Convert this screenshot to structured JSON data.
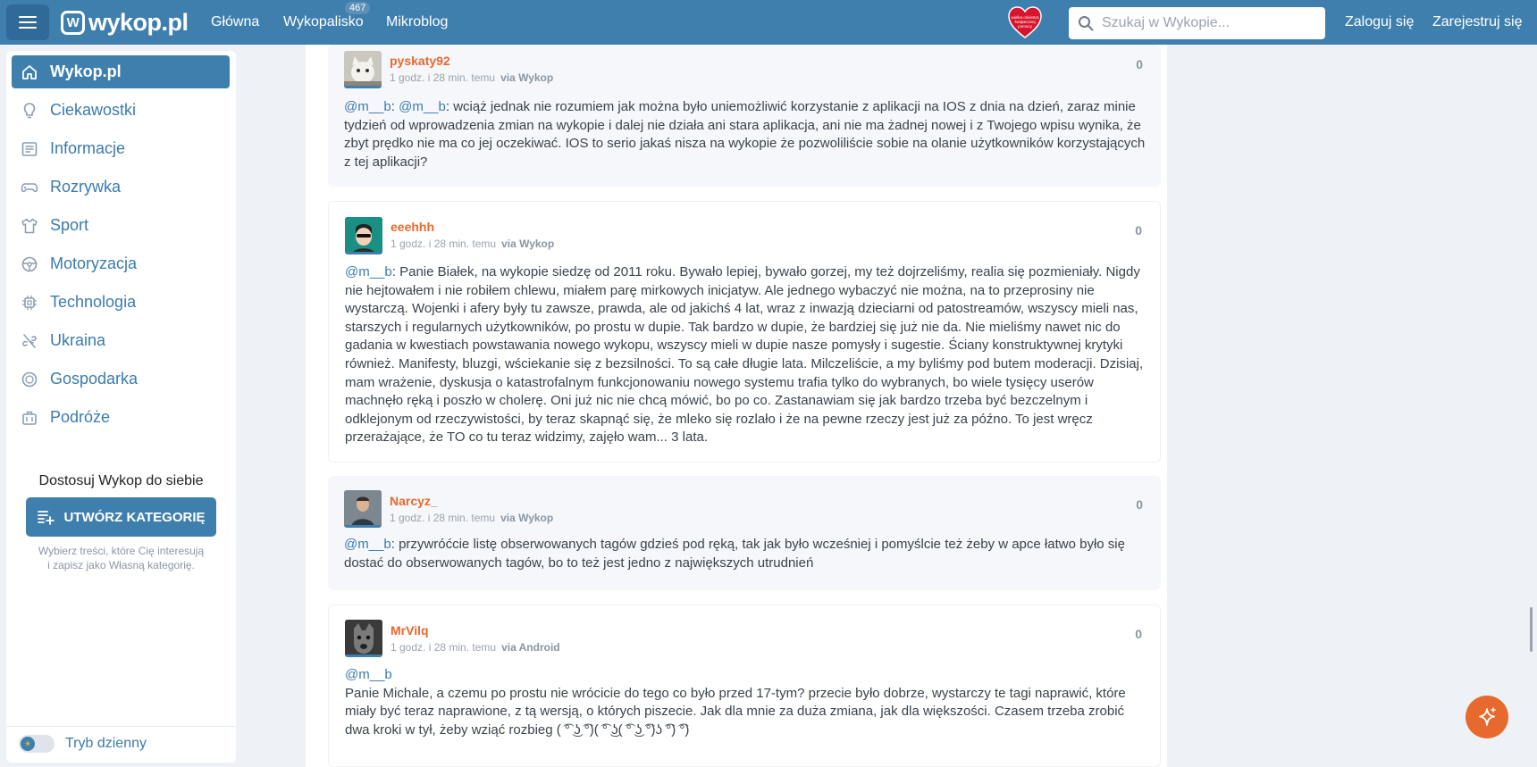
{
  "header": {
    "logo_text": "wykop.pl",
    "nav": [
      {
        "label": "Główna"
      },
      {
        "label": "Wykopalisko",
        "badge": "467"
      },
      {
        "label": "Mikroblog"
      }
    ],
    "heart_text": "wielka orkiestra świątecznej pomocy",
    "search_placeholder": "Szukaj w Wykopie...",
    "login": "Zaloguj się",
    "register": "Zarejestruj się"
  },
  "sidebar": {
    "items": [
      {
        "label": "Wykop.pl",
        "icon": "home-icon"
      },
      {
        "label": "Ciekawostki",
        "icon": "lightbulb-icon"
      },
      {
        "label": "Informacje",
        "icon": "newspaper-icon"
      },
      {
        "label": "Rozrywka",
        "icon": "gamepad-icon"
      },
      {
        "label": "Sport",
        "icon": "shirt-icon"
      },
      {
        "label": "Motoryzacja",
        "icon": "steering-wheel-icon"
      },
      {
        "label": "Technologia",
        "icon": "chip-icon"
      },
      {
        "label": "Ukraina",
        "icon": "ukraine-icon"
      },
      {
        "label": "Gospodarka",
        "icon": "coin-icon"
      },
      {
        "label": "Podróże",
        "icon": "suitcase-icon"
      }
    ],
    "customize_title": "Dostosuj Wykop do siebie",
    "create_button": "UTWÓRZ KATEGORIĘ",
    "customize_desc_1": "Wybierz treści, które Cię interesują",
    "customize_desc_2": "i zapisz jako Własną kategorię.",
    "theme_label": "Tryb dzienny"
  },
  "comments": [
    {
      "user": "pyskaty92",
      "time": "1 godz. i 28 min. temu",
      "via": "via Wykop",
      "votes": "0",
      "mentions": [
        "@m__b",
        "@m__b"
      ],
      "text": "wciąż jednak nie rozumiem jak można było uniemożliwić korzystanie z aplikacji na IOS z dnia na dzień, zaraz minie tydzień od wprowadzenia zmian na wykopie i dalej nie działa ani stara aplikacja, ani nie ma żadnej nowej i z Twojego wpisu wynika, że zbyt prędko nie ma co jej oczekiwać. IOS to serio jakaś nisza na wykopie że pozwoliliście sobie na olanie użytkowników korzystających z tej aplikacji?"
    },
    {
      "user": "eeehhh",
      "time": "1 godz. i 28 min. temu",
      "via": "via Wykop",
      "votes": "0",
      "mention": "@m__b",
      "text": "Panie Białek, na wykopie siedzę od 2011 roku. Bywało lepiej, bywało gorzej, my też dojrzeliśmy, realia się pozmieniały. Nigdy nie hejtowałem i nie robiłem chlewu, miałem parę mirkowych inicjatyw. Ale jednego wybaczyć nie można, na to przeprosiny nie wystarczą. Wojenki i afery były tu zawsze, prawda, ale od jakichś 4 lat, wraz z inwazją dzieciarni od patostreamów, wszyscy mieli nas, starszych i regularnych użytkowników, po prostu w dupie. Tak bardzo w dupie, że bardziej się już nie da. Nie mieliśmy nawet nic do gadania w kwestiach powstawania nowego wykopu, wszyscy mieli w dupie nasze pomysły i sugestie. Ściany konstruktywnej krytyki również. Manifesty, bluzgi, wściekanie się z bezsilności. To są całe długie lata. Milczeliście, a my byliśmy pod butem moderacji. Dzisiaj, mam wrażenie, dyskusja o katastrofalnym funkcjonowaniu nowego systemu trafia tylko do wybranych, bo wiele tysięcy userów machnęło ręką i poszło w cholerę. Oni już nic nie chcą mówić, bo po co. Zastanawiam się jak bardzo trzeba być bezczelnym i odklejonym od rzeczywistości, by teraz skapnąć się, że mleko się rozlało i że na pewne rzeczy jest już za późno. To jest wręcz przerażające, że TO co tu teraz widzimy, zajęło wam... 3 lata."
    },
    {
      "user": "Narcyz_",
      "time": "1 godz. i 28 min. temu",
      "via": "via Wykop",
      "votes": "0",
      "mention": "@m__b",
      "text": "przywróćcie listę obserwowanych tagów gdzieś pod ręką, tak jak było wcześniej i pomyślcie też żeby w apce łatwo było się dostać do obserwowanych tagów, bo to też jest jedno z największych utrudnień"
    },
    {
      "user": "MrVilq",
      "time": "1 godz. i 28 min. temu",
      "via": "via Android",
      "votes": "0",
      "mention": "@m__b",
      "text": "Panie Michale, a czemu po prostu nie wrócicie do tego co było przed 17-tym? przecie było dobrze, wystarczy te tagi naprawić, które miały być teraz naprawione, z tą wersją, o których piszecie. Jak dla mnie za duża zmiana, jak dla większości. Czasem trzeba zrobić dwa kroki w tył, żeby wziąć rozbieg ( ͡° ͜ʖ ͡°)( ͡° ͜ʖ( ͡° ͜ʖ ͡°)ʖ ͡°) ͡°)"
    }
  ],
  "colors": {
    "brand": "#3f7fae",
    "username": "#e8692d",
    "fab": "#e8692d"
  }
}
